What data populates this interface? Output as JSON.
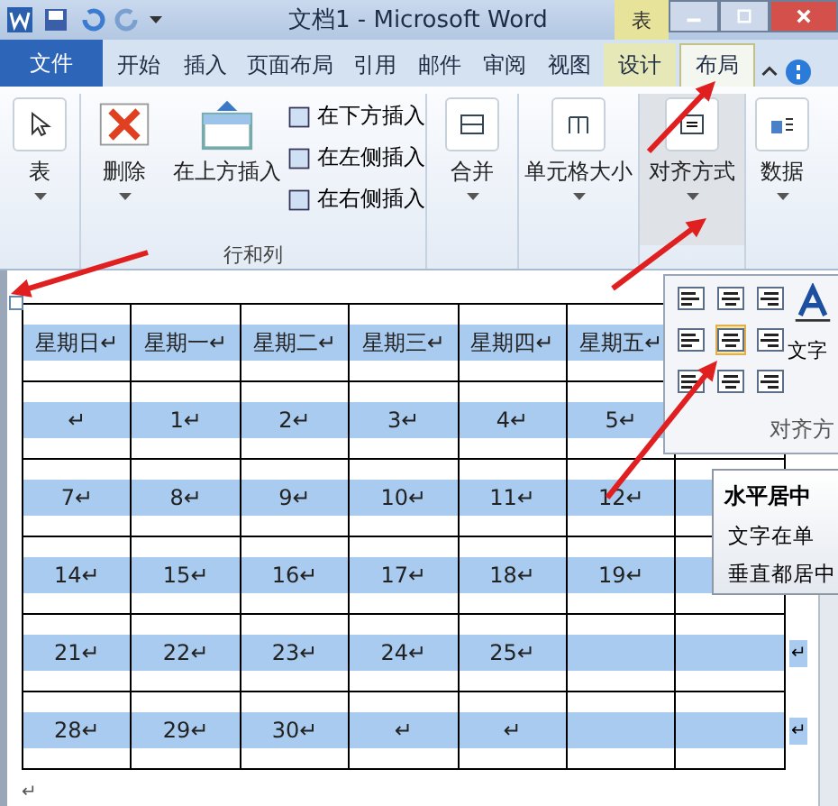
{
  "title_bar": {
    "title": "文档1 - Microsoft Word",
    "context_tab": "表"
  },
  "tabs": [
    {
      "label": "文件",
      "kind": "file",
      "selected": false
    },
    {
      "label": "开始",
      "kind": "normal",
      "selected": false
    },
    {
      "label": "插入",
      "kind": "normal",
      "selected": false
    },
    {
      "label": "页面布局",
      "kind": "normal",
      "selected": false
    },
    {
      "label": "引用",
      "kind": "normal",
      "selected": false
    },
    {
      "label": "邮件",
      "kind": "normal",
      "selected": false
    },
    {
      "label": "审阅",
      "kind": "normal",
      "selected": false
    },
    {
      "label": "视图",
      "kind": "normal",
      "selected": false
    },
    {
      "label": "设计",
      "kind": "context",
      "selected": false
    },
    {
      "label": "布局",
      "kind": "context",
      "selected": true
    }
  ],
  "ribbon": {
    "table": "表",
    "rows_columns": {
      "label": "行和列",
      "delete": "删除",
      "insert_above": "在上方插入",
      "small": [
        "在下方插入",
        "在左侧插入",
        "在右侧插入"
      ]
    },
    "merge": "合并",
    "cell_size": "单元格大小",
    "alignment": {
      "label": "对齐方式",
      "pressed": true
    },
    "data": "数据"
  },
  "alignment_menu": {
    "buttons": [
      {
        "kind": "left",
        "selected": false
      },
      {
        "kind": "center",
        "selected": false
      },
      {
        "kind": "right",
        "selected": false
      },
      {
        "kind": "left",
        "selected": false
      },
      {
        "kind": "center",
        "selected": true
      },
      {
        "kind": "right",
        "selected": false
      },
      {
        "kind": "left",
        "selected": false
      },
      {
        "kind": "center",
        "selected": false
      },
      {
        "kind": "right",
        "selected": false
      }
    ],
    "side_label": "文字",
    "label": "对齐方"
  },
  "tooltip": {
    "title": "水平居中",
    "lines": [
      "文字在单",
      "垂直都居中"
    ]
  },
  "table": {
    "rows": [
      {
        "cells": [
          "星期日↵",
          "星期一↵",
          "星期二↵",
          "星期三↵",
          "星期四↵",
          "星期五↵"
        ]
      },
      {
        "cells": [
          "↵",
          "1↵",
          "2↵",
          "3↵",
          "4↵",
          "5↵"
        ]
      },
      {
        "cells": [
          "7↵",
          "8↵",
          "9↵",
          "10↵",
          "11↵",
          "12↵"
        ]
      },
      {
        "cells": [
          "14↵",
          "15↵",
          "16↵",
          "17↵",
          "18↵",
          "19↵"
        ]
      },
      {
        "cells": [
          "21↵",
          "22↵",
          "23↵",
          "24↵",
          "25↵"
        ],
        "end_mark": "↵"
      },
      {
        "cells": [
          "28↵",
          "29↵",
          "30↵",
          "↵",
          "↵"
        ],
        "end_mark": "↵"
      }
    ],
    "after": "↵"
  }
}
